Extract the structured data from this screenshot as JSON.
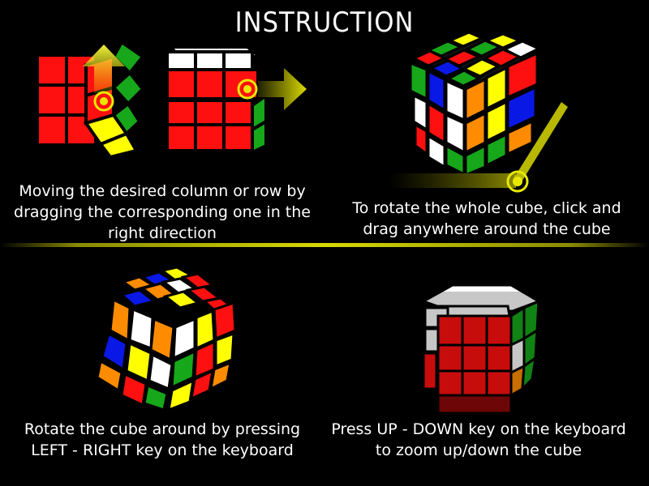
{
  "title": "INSTRUCTION",
  "colors": {
    "red": "#ff1010",
    "green": "#17a71a",
    "blue": "#0a18e6",
    "yellow": "#ffff00",
    "orange": "#ff8c00",
    "white": "#ffffff",
    "accent": "#d8d800"
  },
  "panels": [
    {
      "name": "drag-row-column",
      "caption_lines": [
        "Moving the desired column or row by",
        "dragging the corresponding one in the",
        "right direction"
      ]
    },
    {
      "name": "rotate-whole-cube",
      "caption_lines": [
        "To rotate the whole cube, click and",
        "drag anywhere around the cube"
      ]
    },
    {
      "name": "keyboard-rotate",
      "caption_lines": [
        "Rotate the cube around by pressing",
        "LEFT - RIGHT key on the keyboard"
      ]
    },
    {
      "name": "keyboard-zoom",
      "caption_lines": [
        "Press UP - DOWN key on the keyboard",
        "to zoom up/down the cube"
      ]
    }
  ]
}
